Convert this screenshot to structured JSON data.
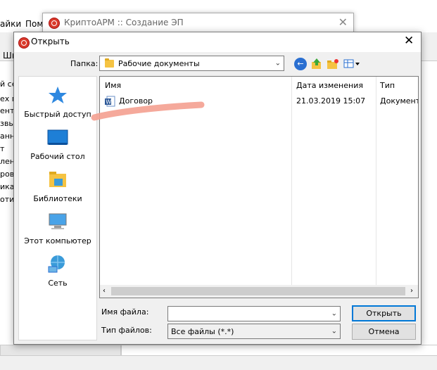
{
  "background_app": {
    "menu": [
      "айки",
      "Пом"
    ],
    "toolbar_label": "Ши",
    "list_items": [
      "й сер",
      "ех по",
      "ентр",
      "звые",
      "анны",
      "т",
      "ление",
      "ров",
      "икат",
      "отис"
    ]
  },
  "behind_window": {
    "title": "КриптоАРМ :: Создание ЭП",
    "close": "✕"
  },
  "dialog": {
    "title": "Открыть",
    "close": "✕",
    "folder_label": "Папка:",
    "folder_value": "Рабочие документы",
    "places": [
      {
        "label": "Быстрый доступ",
        "icon": "quick-access-icon"
      },
      {
        "label": "Рабочий стол",
        "icon": "desktop-icon"
      },
      {
        "label": "Библиотеки",
        "icon": "libraries-icon"
      },
      {
        "label": "Этот компьютер",
        "icon": "this-pc-icon"
      },
      {
        "label": "Сеть",
        "icon": "network-icon"
      }
    ],
    "columns": {
      "name": "Имя",
      "date": "Дата изменения",
      "type": "Тип"
    },
    "files": [
      {
        "name": "Договор",
        "date": "21.03.2019 15:07",
        "type": "Документ"
      }
    ],
    "filename_label": "Имя файла:",
    "filename_value": "",
    "filetype_label": "Тип файлов:",
    "filetype_value": "Все файлы (*.*)",
    "open_button": "Открыть",
    "cancel_button": "Отмена"
  }
}
